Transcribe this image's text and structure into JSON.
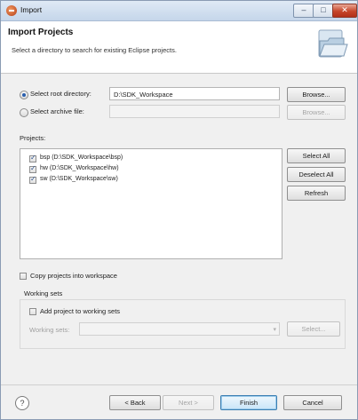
{
  "window": {
    "title": "Import",
    "banner_title": "Import Projects",
    "banner_description": "Select a directory to search for existing Eclipse projects."
  },
  "source": {
    "root_radio_label": "Select root directory:",
    "root_path": "D:\\SDK_Workspace",
    "root_selected": true,
    "root_browse_label": "Browse...",
    "archive_radio_label": "Select archive file:",
    "archive_path": "",
    "archive_browse_label": "Browse..."
  },
  "projects": {
    "label": "Projects:",
    "items": [
      {
        "label": "bsp (D:\\SDK_Workspace\\bsp)",
        "checked": true
      },
      {
        "label": "hw (D:\\SDK_Workspace\\hw)",
        "checked": true
      },
      {
        "label": "sw (D:\\SDK_Workspace\\sw)",
        "checked": true
      }
    ],
    "select_all_label": "Select All",
    "deselect_all_label": "Deselect All",
    "refresh_label": "Refresh"
  },
  "options": {
    "copy_projects_label": "Copy projects into workspace",
    "copy_projects_checked": false
  },
  "working_sets": {
    "group_label": "Working sets",
    "add_label": "Add project to working sets",
    "add_checked": false,
    "field_label": "Working sets:",
    "field_value": "",
    "select_label": "Select..."
  },
  "footer": {
    "help_symbol": "?",
    "back_label": "< Back",
    "next_label": "Next >",
    "finish_label": "Finish",
    "cancel_label": "Cancel"
  },
  "icons": {
    "app": "eclipse-import-icon",
    "banner": "open-folder-icon",
    "help": "help-icon"
  }
}
